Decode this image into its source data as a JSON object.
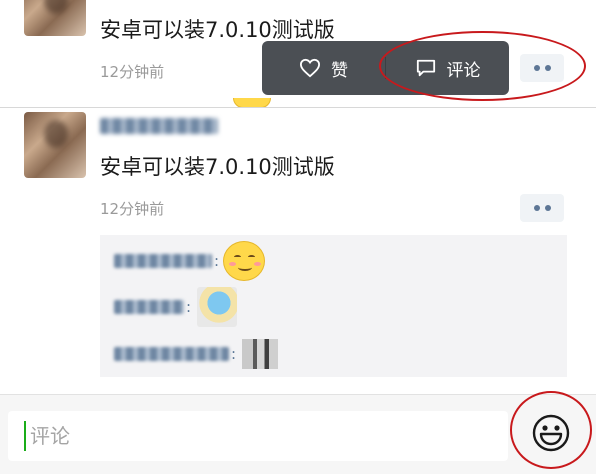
{
  "posts": [
    {
      "text": "安卓可以装7.0.10测试版",
      "time": "12分钟前"
    },
    {
      "text": "安卓可以装7.0.10测试版",
      "time": "12分钟前"
    }
  ],
  "action_popup": {
    "like_label": "赞",
    "comment_label": "评论"
  },
  "comment_bar": {
    "placeholder": "评论"
  },
  "colors": {
    "annotation_red": "#c8191c",
    "popup_bg": "#4b4f54",
    "link_blue": "#5d7695",
    "caret_green": "#1aad19"
  },
  "icons": [
    "heart-icon",
    "comment-bubble-icon",
    "more-dots-icon",
    "smiley-icon"
  ]
}
